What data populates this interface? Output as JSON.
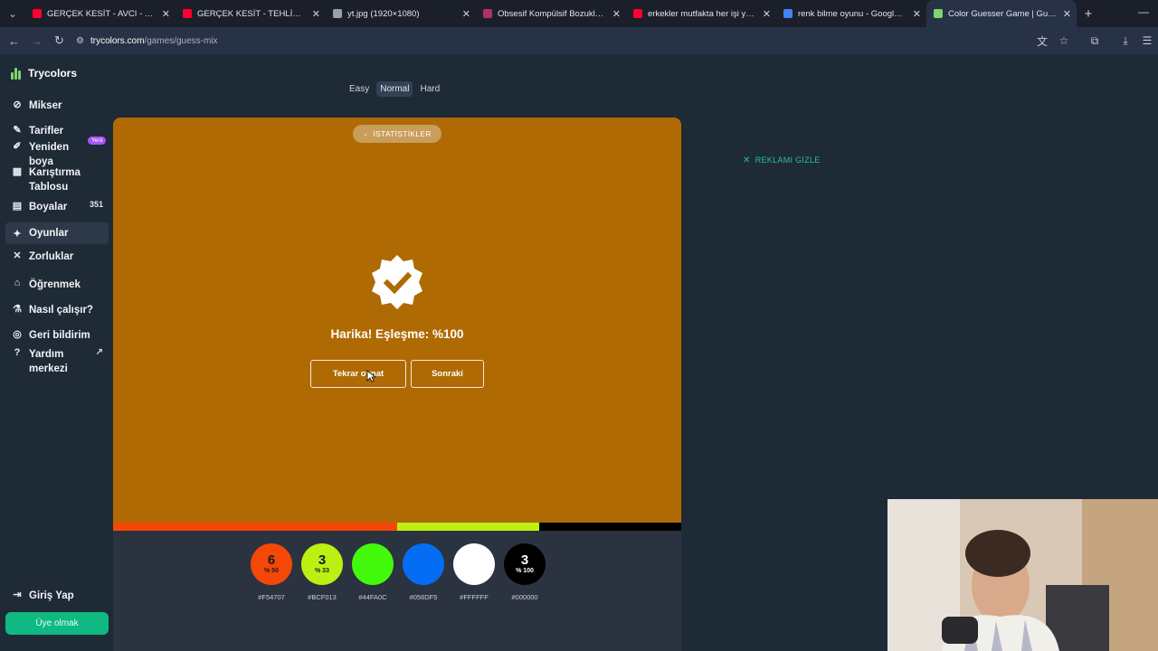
{
  "browser": {
    "tabs": [
      {
        "title": "GERÇEK KESİT - AVCI - YouTube",
        "favicon": "youtube-icon",
        "color": "#ff0033"
      },
      {
        "title": "GERÇEK KESİT - TEHLİKELİ OYUNLAR",
        "favicon": "youtube-icon",
        "color": "#ff0033"
      },
      {
        "title": "yt.jpg (1920×1080)",
        "favicon": "globe-icon",
        "color": "#9aa0aa"
      },
      {
        "title": "Obsesif Kompülsif Bozukluk Testi",
        "favicon": "site-icon",
        "color": "#b0306a"
      },
      {
        "title": "erkekler mutfakta her işi yaptılar",
        "favicon": "youtube-icon",
        "color": "#ff0033"
      },
      {
        "title": "renk bilme oyunu - Google'da Ara",
        "favicon": "google-icon",
        "color": "#4285f4"
      },
      {
        "title": "Color Guesser Game | Guess the",
        "favicon": "trycolors-icon",
        "color": "#7dd56f"
      }
    ],
    "active_tab": 6,
    "url_site": "trycolors.com",
    "url_path": "/games/guess-mix"
  },
  "sidebar": {
    "brand": "Trycolors",
    "items": [
      {
        "label": "Mikser",
        "icon": "mixer-icon"
      },
      {
        "label": "Tarifler",
        "icon": "recipes-icon"
      },
      {
        "label": "Yeniden boya",
        "icon": "brush-icon",
        "badge": "Yeni"
      },
      {
        "label": "Karıştırma Tablosu",
        "icon": "grid-icon"
      },
      {
        "label": "Boyalar",
        "icon": "paints-icon",
        "count": "351"
      },
      {
        "label": "Oyunlar",
        "icon": "games-icon"
      },
      {
        "label": "Zorluklar",
        "icon": "challenges-icon"
      },
      {
        "label": "Öğrenmek",
        "icon": "graduation-cap-icon"
      },
      {
        "label": "Nasıl çalışır?",
        "icon": "flask-icon"
      },
      {
        "label": "Geri bildirim",
        "icon": "feedback-icon"
      },
      {
        "label": "Yardım merkezi",
        "icon": "help-icon"
      }
    ],
    "active_item": "Oyunlar",
    "login": "Giriş Yap",
    "member_button": "Üye olmak"
  },
  "difficulty": {
    "options": [
      "Easy",
      "Normal",
      "Hard"
    ],
    "selected": "Normal"
  },
  "game": {
    "background": "#B06A03",
    "stats_button": "İSTATİSTİKLER",
    "result_text": "Harika! Eşleşme: %100",
    "retry_button": "Tekrar oynat",
    "next_button": "Sonraki",
    "mix_bar": [
      {
        "color": "#F54707",
        "share": 0.5
      },
      {
        "color": "#BCF013",
        "share": 0.25
      },
      {
        "color": "#000000",
        "share": 0.25
      }
    ]
  },
  "palette": [
    {
      "hex": "#F54707",
      "count": "6",
      "percent": "% 50"
    },
    {
      "hex": "#BCF013",
      "count": "3",
      "percent": "% 33"
    },
    {
      "hex": "#44FA0C",
      "count": "",
      "percent": ""
    },
    {
      "hex": "#056DF5",
      "count": "",
      "percent": ""
    },
    {
      "hex": "#FFFFFF",
      "count": "",
      "percent": ""
    },
    {
      "hex": "#000000",
      "count": "3",
      "percent": "% 100"
    }
  ],
  "ad": {
    "hide_label": "REKLAMI GİZLE"
  }
}
